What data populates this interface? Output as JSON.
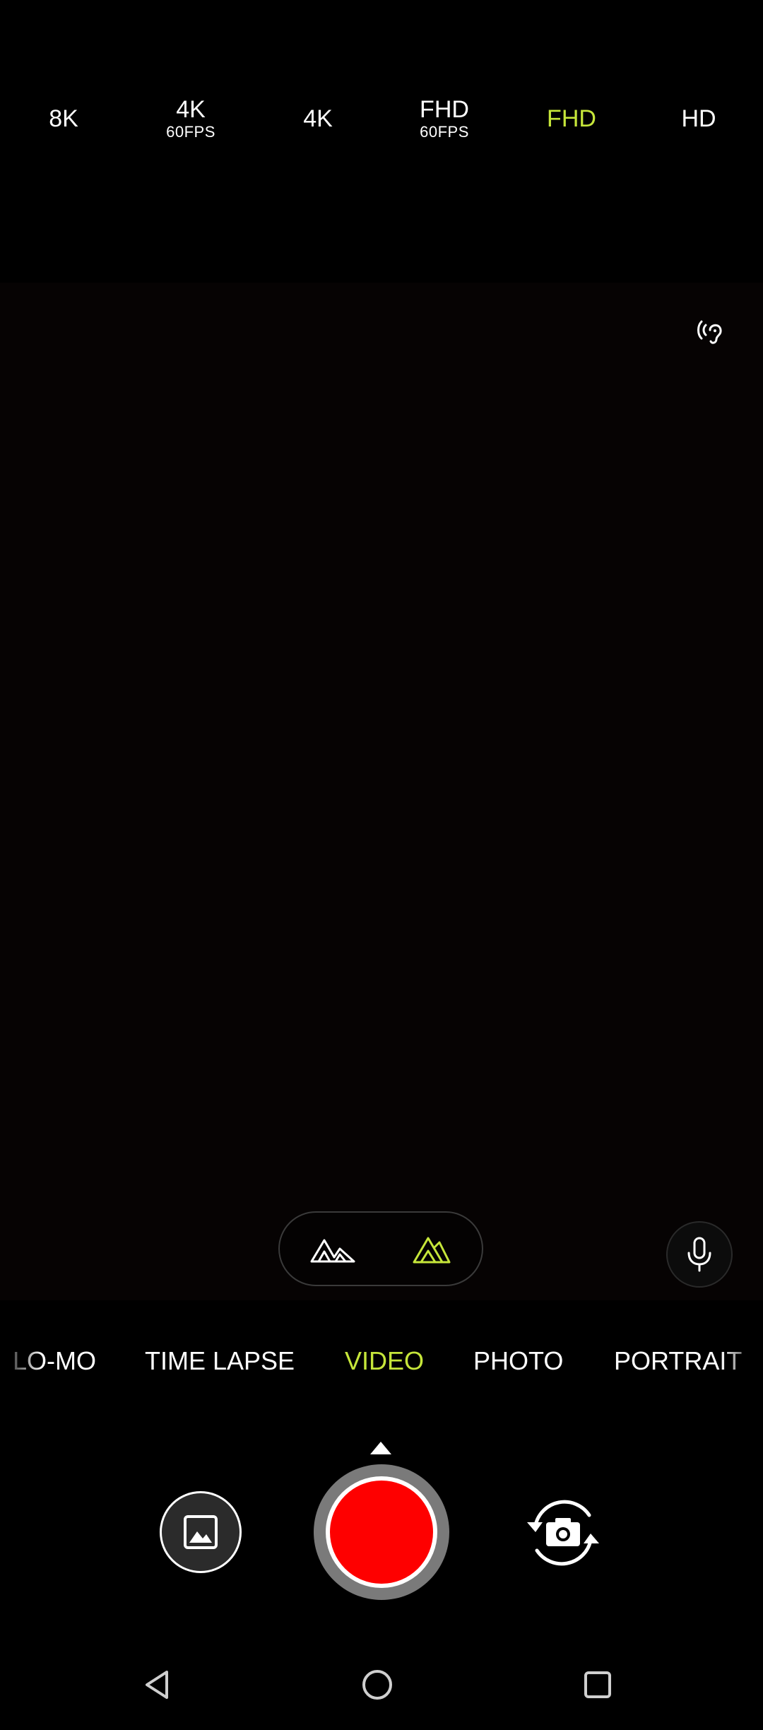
{
  "resolution_options": [
    {
      "label": "8K",
      "sub": ""
    },
    {
      "label": "4K",
      "sub": "60FPS"
    },
    {
      "label": "4K",
      "sub": ""
    },
    {
      "label": "FHD",
      "sub": "60FPS"
    },
    {
      "label": "FHD",
      "sub": "",
      "selected": true
    },
    {
      "label": "HD",
      "sub": ""
    }
  ],
  "icons": {
    "hearing": "hearing-assist-icon",
    "lens_wide": "ultra-wide-lens-icon",
    "lens_normal": "standard-lens-icon",
    "mic": "microphone-icon",
    "gallery": "gallery-icon",
    "switch_camera": "switch-camera-icon",
    "caret": "caret-up-icon",
    "nav_back": "back-triangle-icon",
    "nav_home": "home-circle-icon",
    "nav_recents": "recents-square-icon"
  },
  "modes": [
    {
      "label": "LO-MO"
    },
    {
      "label": "TIME LAPSE"
    },
    {
      "label": "VIDEO",
      "selected": true
    },
    {
      "label": "PHOTO"
    },
    {
      "label": "PORTRAIT"
    }
  ],
  "colors": {
    "accent": "#c6e63a",
    "record": "#fe0000",
    "background": "#000000"
  }
}
